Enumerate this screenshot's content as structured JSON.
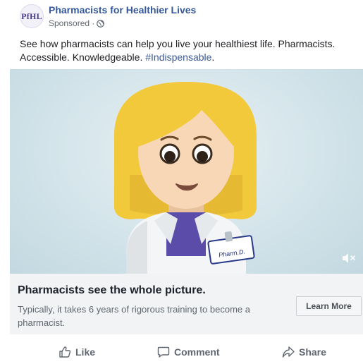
{
  "page": {
    "avatar_text": "PfHL",
    "name": "Pharmacists for Healthier Lives",
    "sponsored": "Sponsored · "
  },
  "post": {
    "text_main": "See how pharmacists can help you live your healthiest life. Pharmacists. Accessible. Knowledgeable. ",
    "hashtag": "#Indispensable",
    "text_end": "."
  },
  "media": {
    "badge_text": "Pharm.D.",
    "mute_icon": "speaker-muted-icon"
  },
  "cta": {
    "title": "Pharmacists see the whole picture.",
    "description": "Typically, it takes 6 years of rigorous training to become a pharmacist.",
    "button_label": "Learn More"
  },
  "actions": {
    "like": "Like",
    "comment": "Comment",
    "share": "Share"
  },
  "colors": {
    "link_blue": "#365899",
    "text_dark": "#1c1e21",
    "text_muted": "#606770",
    "cta_bg": "#f2f3f5",
    "hair": "#f3c93c",
    "skin": "#f7d7b5",
    "shirt": "#5b4caa"
  }
}
